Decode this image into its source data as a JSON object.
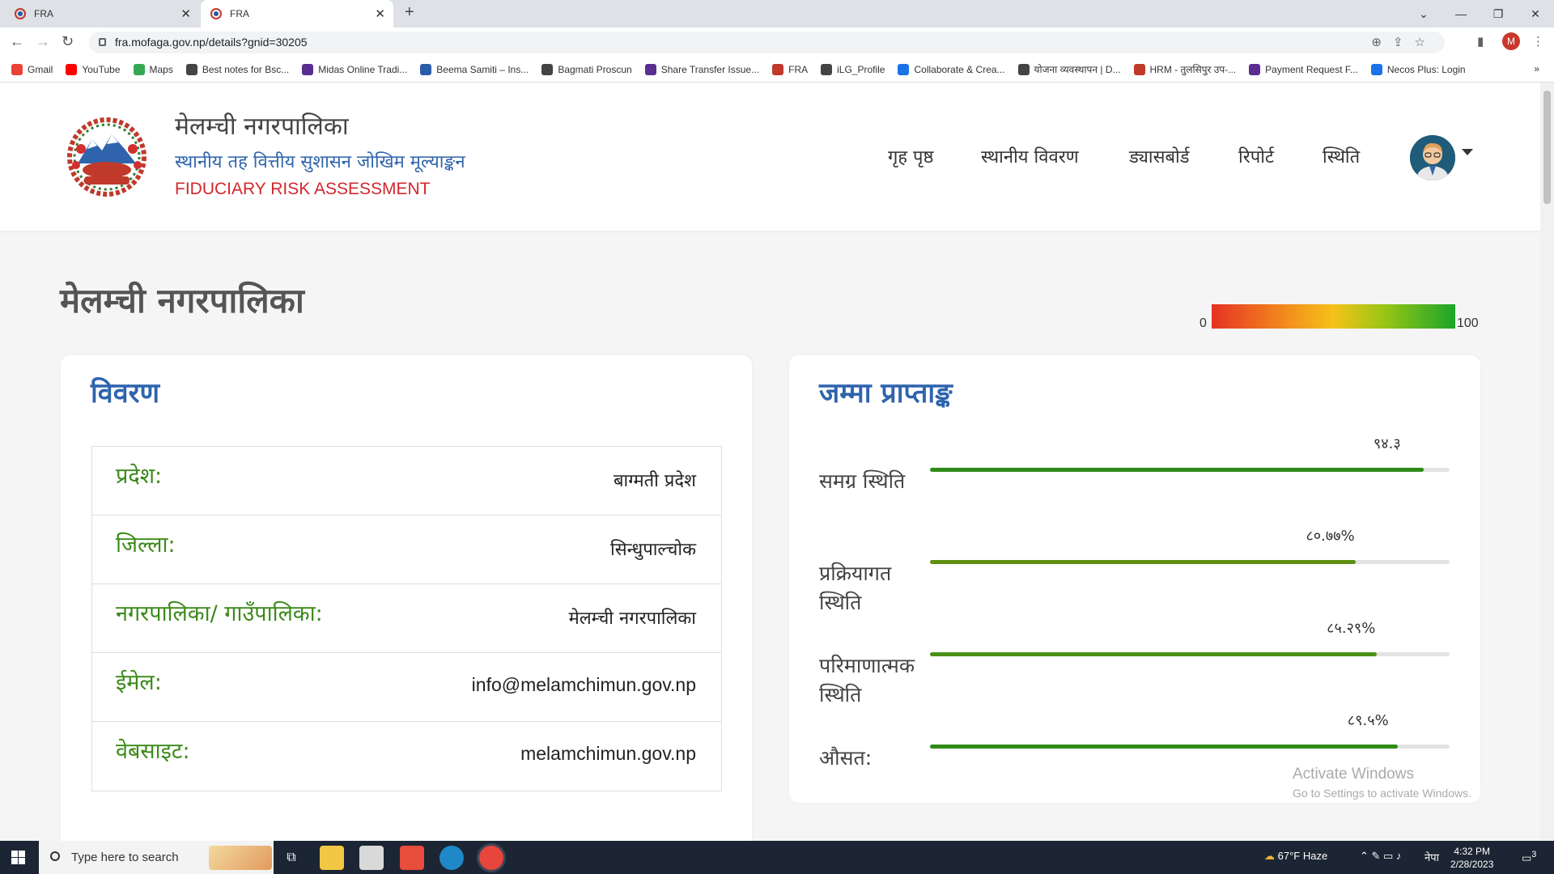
{
  "browser": {
    "tabs": [
      {
        "label": "FRA",
        "active": false
      },
      {
        "label": "FRA",
        "active": true
      }
    ],
    "url": "fra.mofaga.gov.np/details?gnid=30205",
    "profile_initial": "M",
    "bookmarks": [
      {
        "label": "Gmail",
        "color": "#ea4335"
      },
      {
        "label": "YouTube",
        "color": "#ff0000"
      },
      {
        "label": "Maps",
        "color": "#34a853"
      },
      {
        "label": "Best notes for Bsc...",
        "color": "#444444"
      },
      {
        "label": "Midas Online Tradi...",
        "color": "#5b2d90"
      },
      {
        "label": "Beema Samiti – Ins...",
        "color": "#2b5caa"
      },
      {
        "label": "Bagmati Proscun",
        "color": "#444444"
      },
      {
        "label": "Share Transfer Issue...",
        "color": "#5b2d90"
      },
      {
        "label": "FRA",
        "color": "#c0392b"
      },
      {
        "label": "iLG_Profile",
        "color": "#444444"
      },
      {
        "label": "Collaborate & Crea...",
        "color": "#1a73e8"
      },
      {
        "label": "योजना व्यवस्थापन | D...",
        "color": "#444444"
      },
      {
        "label": "HRM - तुलसिपुर उप-...",
        "color": "#c0392b"
      },
      {
        "label": "Payment Request F...",
        "color": "#5b2d90"
      },
      {
        "label": "Necos Plus: Login",
        "color": "#1a73e8"
      }
    ],
    "bookmarks_more": "»"
  },
  "header": {
    "org_name": "मेलम्ची नगरपालिका",
    "subtitle": "स्थानीय तह वित्तीय सुशासन जोखिम मूल्याङ्कन",
    "english_title": "FIDUCIARY RISK ASSESSMENT",
    "nav": [
      "गृह पृष्ठ",
      "स्थानीय विवरण",
      "ड्यासबोर्ड",
      "रिपोर्ट",
      "स्थिति"
    ]
  },
  "page": {
    "title": "मेलम्ची नगरपालिका",
    "legend": {
      "min": "0",
      "max": "100"
    }
  },
  "details": {
    "title": "विवरण",
    "rows": [
      {
        "label": "प्रदेश:",
        "value": "बाग्मती प्रदेश"
      },
      {
        "label": "जिल्ला:",
        "value": "सिन्धुपाल्चोक"
      },
      {
        "label": "नगरपालिका/ गाउँपालिका:",
        "value": "मेलम्ची नगरपालिका"
      },
      {
        "label": "ईमेल:",
        "value": "info@melamchimun.gov.np"
      },
      {
        "label": "वेबसाइट:",
        "value": "melamchimun.gov.np"
      }
    ]
  },
  "score": {
    "title": "जम्मा प्राप्ताङ्क",
    "metrics": [
      {
        "label": "समग्र स्थिति",
        "value_text": "९४.३",
        "value": 95,
        "color": "#2e8b17"
      },
      {
        "label": "प्रक्रियागत स्थिति",
        "value_text": "८०.७७%",
        "value": 82,
        "color": "#5e8f12"
      },
      {
        "label": "परिमाणात्मक स्थिति",
        "value_text": "८५.२९%",
        "value": 86,
        "color": "#4a9216"
      },
      {
        "label": "औसत:",
        "value_text": "८९.५%",
        "value": 90,
        "color": "#2e8b17"
      }
    ]
  },
  "watermark": {
    "line1": "Activate Windows",
    "line2": "Go to Settings to activate Windows."
  },
  "taskbar": {
    "search_placeholder": "Type here to search",
    "weather": "67°F  Haze",
    "lang": "नेपा",
    "time": "4:32 PM",
    "date": "2/28/2023",
    "notifications": "3"
  }
}
